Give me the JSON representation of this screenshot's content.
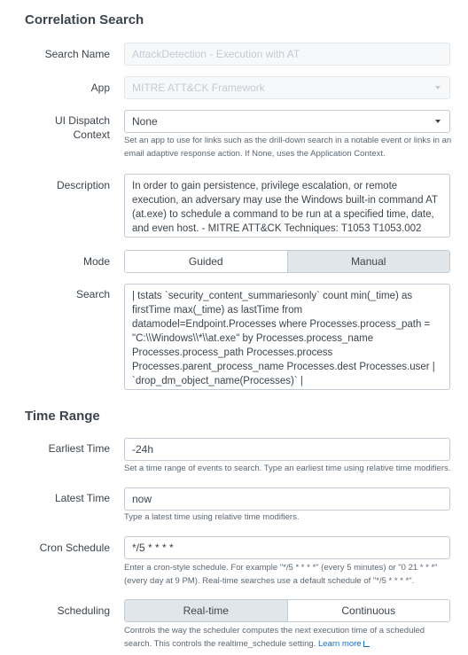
{
  "correlation": {
    "section_title": "Correlation Search",
    "search_name": {
      "label": "Search Name",
      "value": "AttackDetection - Execution with AT"
    },
    "app": {
      "label": "App",
      "value": "MITRE ATT&CK Framework"
    },
    "ui_dispatch": {
      "label_line1": "UI Dispatch",
      "label_line2": "Context",
      "value": "None",
      "help": "Set an app to use for links such as the drill-down search in a notable event or links in an email adaptive response action. If None, uses the Application Context."
    },
    "description": {
      "label": "Description",
      "value": "In order to gain persistence, privilege escalation, or remote execution, an adversary may use the Windows built-in command AT (at.exe) to schedule a command to be run at a specified time, date, and even host. - MITRE ATT&CK Techniques: T1053 T1053.002"
    },
    "mode": {
      "label": "Mode",
      "options": [
        "Guided",
        "Manual"
      ],
      "selected": "Manual"
    },
    "search": {
      "label": "Search",
      "value": "| tstats `security_content_summariesonly` count min(_time) as firstTime max(_time) as lastTime from datamodel=Endpoint.Processes where Processes.process_path = \"C:\\\\Windows\\\\*\\\\at.exe\" by Processes.process_name Processes.process_path Processes.process Processes.parent_process_name Processes.dest Processes.user | `drop_dm_object_name(Processes)` | `security_content_ctime(firstTime)` | `security_content_ctime(lastTime)`"
    }
  },
  "time_range": {
    "section_title": "Time Range",
    "earliest": {
      "label": "Earliest Time",
      "value": "-24h",
      "help": "Set a time range of events to search. Type an earliest time using relative time modifiers."
    },
    "latest": {
      "label": "Latest Time",
      "value": "now",
      "help": "Type a latest time using relative time modifiers."
    },
    "cron": {
      "label": "Cron Schedule",
      "value": "*/5 * * * *",
      "help": "Enter a cron-style schedule. For example \"*/5 * * * *\" (every 5 minutes) or \"0 21 * * *\" (every day at 9 PM). Real-time searches use a default schedule of \"*/5 * * * *\"."
    },
    "scheduling": {
      "label": "Scheduling",
      "options": [
        "Real-time",
        "Continuous"
      ],
      "selected": "Real-time",
      "help": "Controls the way the scheduler computes the next execution time of a scheduled search. This controls the realtime_schedule setting.",
      "learn_more": "Learn more"
    }
  },
  "colors": {
    "text": "#3c444d",
    "border": "#c3cbd4",
    "selected_toggle": "#e1e6eb",
    "link": "#1a6fc4",
    "disabled_text": "#c3cbd4"
  },
  "icons": {
    "dropdown": "caret-down-icon",
    "external": "external-link-icon"
  }
}
